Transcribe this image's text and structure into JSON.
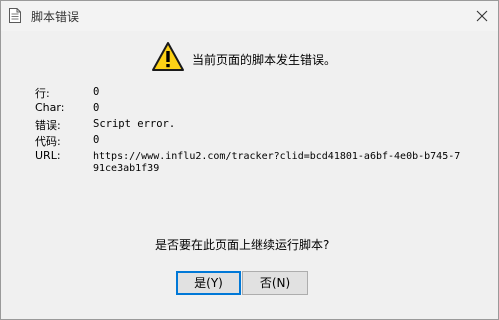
{
  "window": {
    "title": "脚本错误"
  },
  "message": "当前页面的脚本发生错误。",
  "details": {
    "line_label": "行:",
    "line_value": "0",
    "char_label": "Char:",
    "char_value": "0",
    "error_label": "错误:",
    "error_value": "Script error.",
    "code_label": "代码:",
    "code_value": "0",
    "url_label": "URL:",
    "url_value": "https://www.influ2.com/tracker?clid=bcd41801-a6bf-4e0b-b745-791ce3ab1f39"
  },
  "question": "是否要在此页面上继续运行脚本?",
  "buttons": {
    "yes_label": "是(Y)",
    "no_label": "否(N)"
  },
  "icons": {
    "title": "document-icon",
    "warning": "warning-icon",
    "close": "close-icon"
  },
  "colors": {
    "warning_yellow": "#fcd116",
    "focus_border": "#0078d7"
  }
}
